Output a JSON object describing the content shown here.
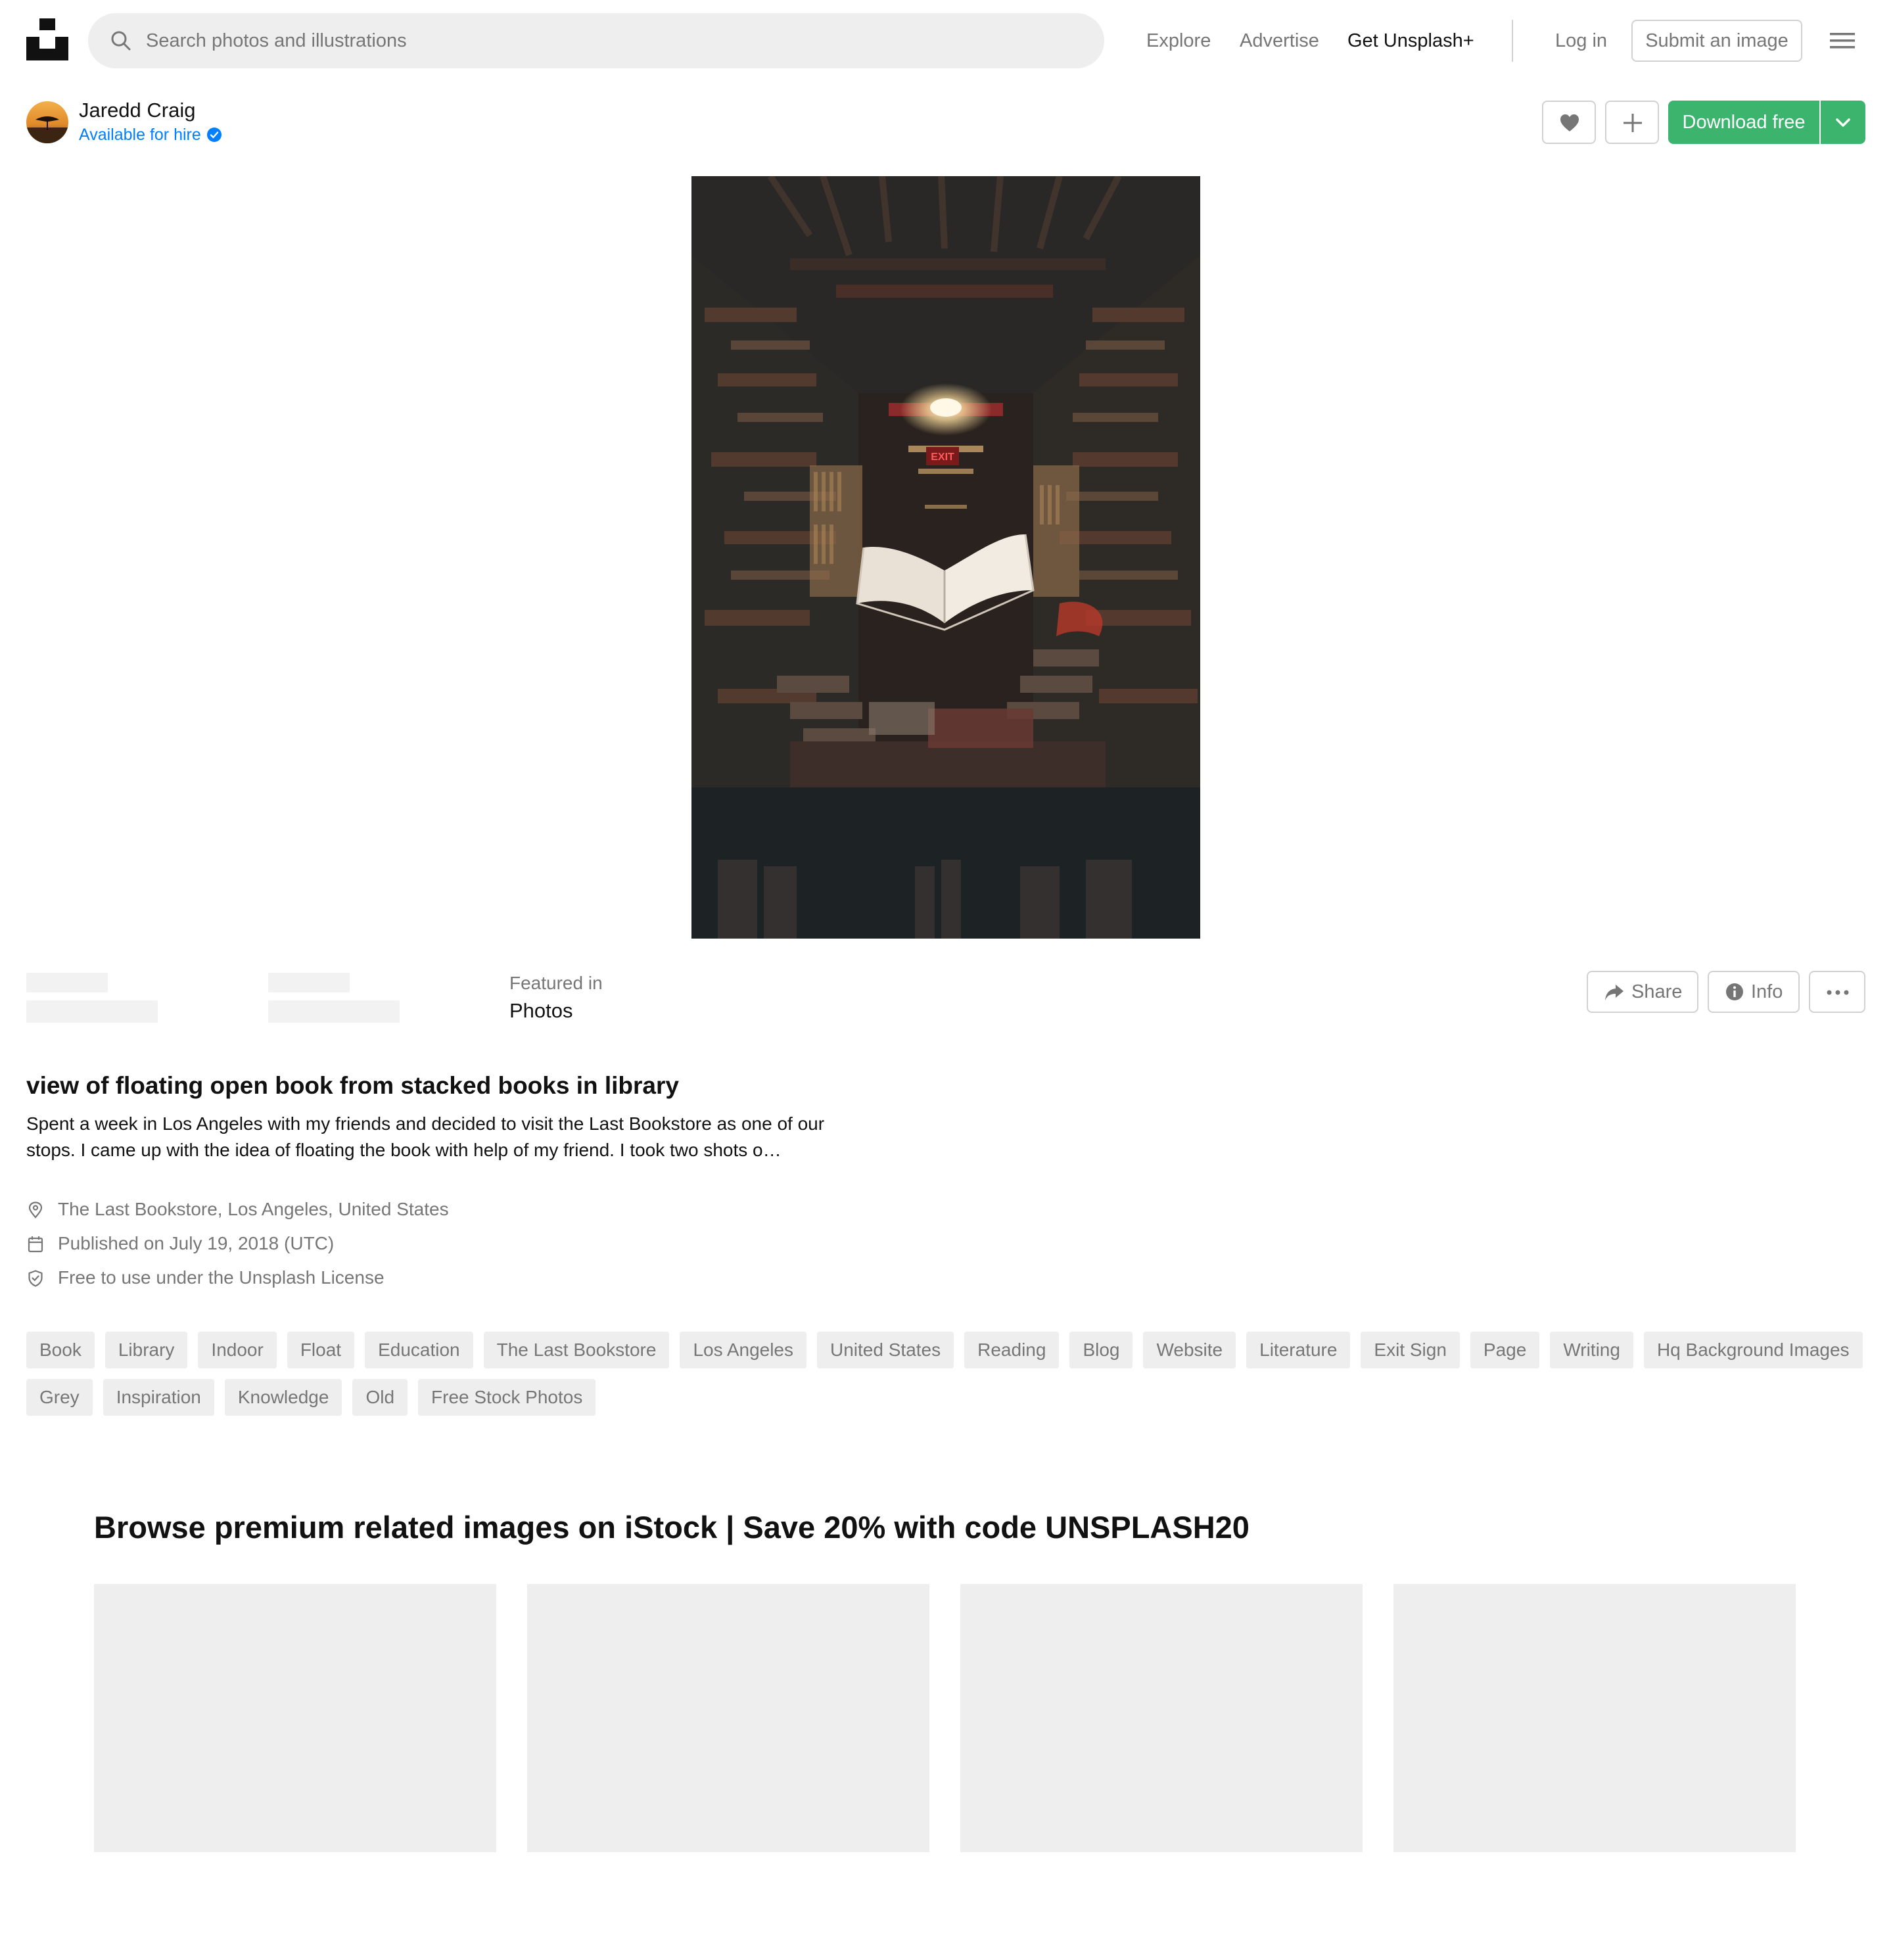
{
  "header": {
    "search_placeholder": "Search photos and illustrations",
    "nav": {
      "explore": "Explore",
      "advertise": "Advertise",
      "plus": "Get Unsplash+"
    },
    "login": "Log in",
    "submit": "Submit an image"
  },
  "user": {
    "name": "Jaredd Craig",
    "availability": "Available for hire"
  },
  "actions": {
    "download": "Download free",
    "share": "Share",
    "info": "Info"
  },
  "featured": {
    "label": "Featured in",
    "value": "Photos"
  },
  "photo": {
    "title": "view of floating open book from stacked books in library",
    "description": "Spent a week in Los Angeles with my friends and decided to visit the Last Bookstore as one of our stops. I came up with the idea of floating the book with help of my friend. I took two shots o…",
    "location": "The Last Bookstore, Los Angeles, United States",
    "published": "Published on July 19, 2018 (UTC)",
    "license": "Free to use under the Unsplash License",
    "exit_sign": "EXIT"
  },
  "tags": [
    "Book",
    "Library",
    "Indoor",
    "Float",
    "Education",
    "The Last Bookstore",
    "Los Angeles",
    "United States",
    "Reading",
    "Blog",
    "Website",
    "Literature",
    "Exit Sign",
    "Page",
    "Writing",
    "Hq Background Images",
    "Grey",
    "Inspiration",
    "Knowledge",
    "Old",
    "Free Stock Photos"
  ],
  "istock": {
    "title": "Browse premium related images on iStock | Save 20% with code UNSPLASH20"
  },
  "colors": {
    "accent_green": "#3cb46e",
    "link_blue": "#007fff",
    "muted_text": "#767676",
    "border": "#d1d1d1",
    "chip_bg": "#eeeeee"
  }
}
